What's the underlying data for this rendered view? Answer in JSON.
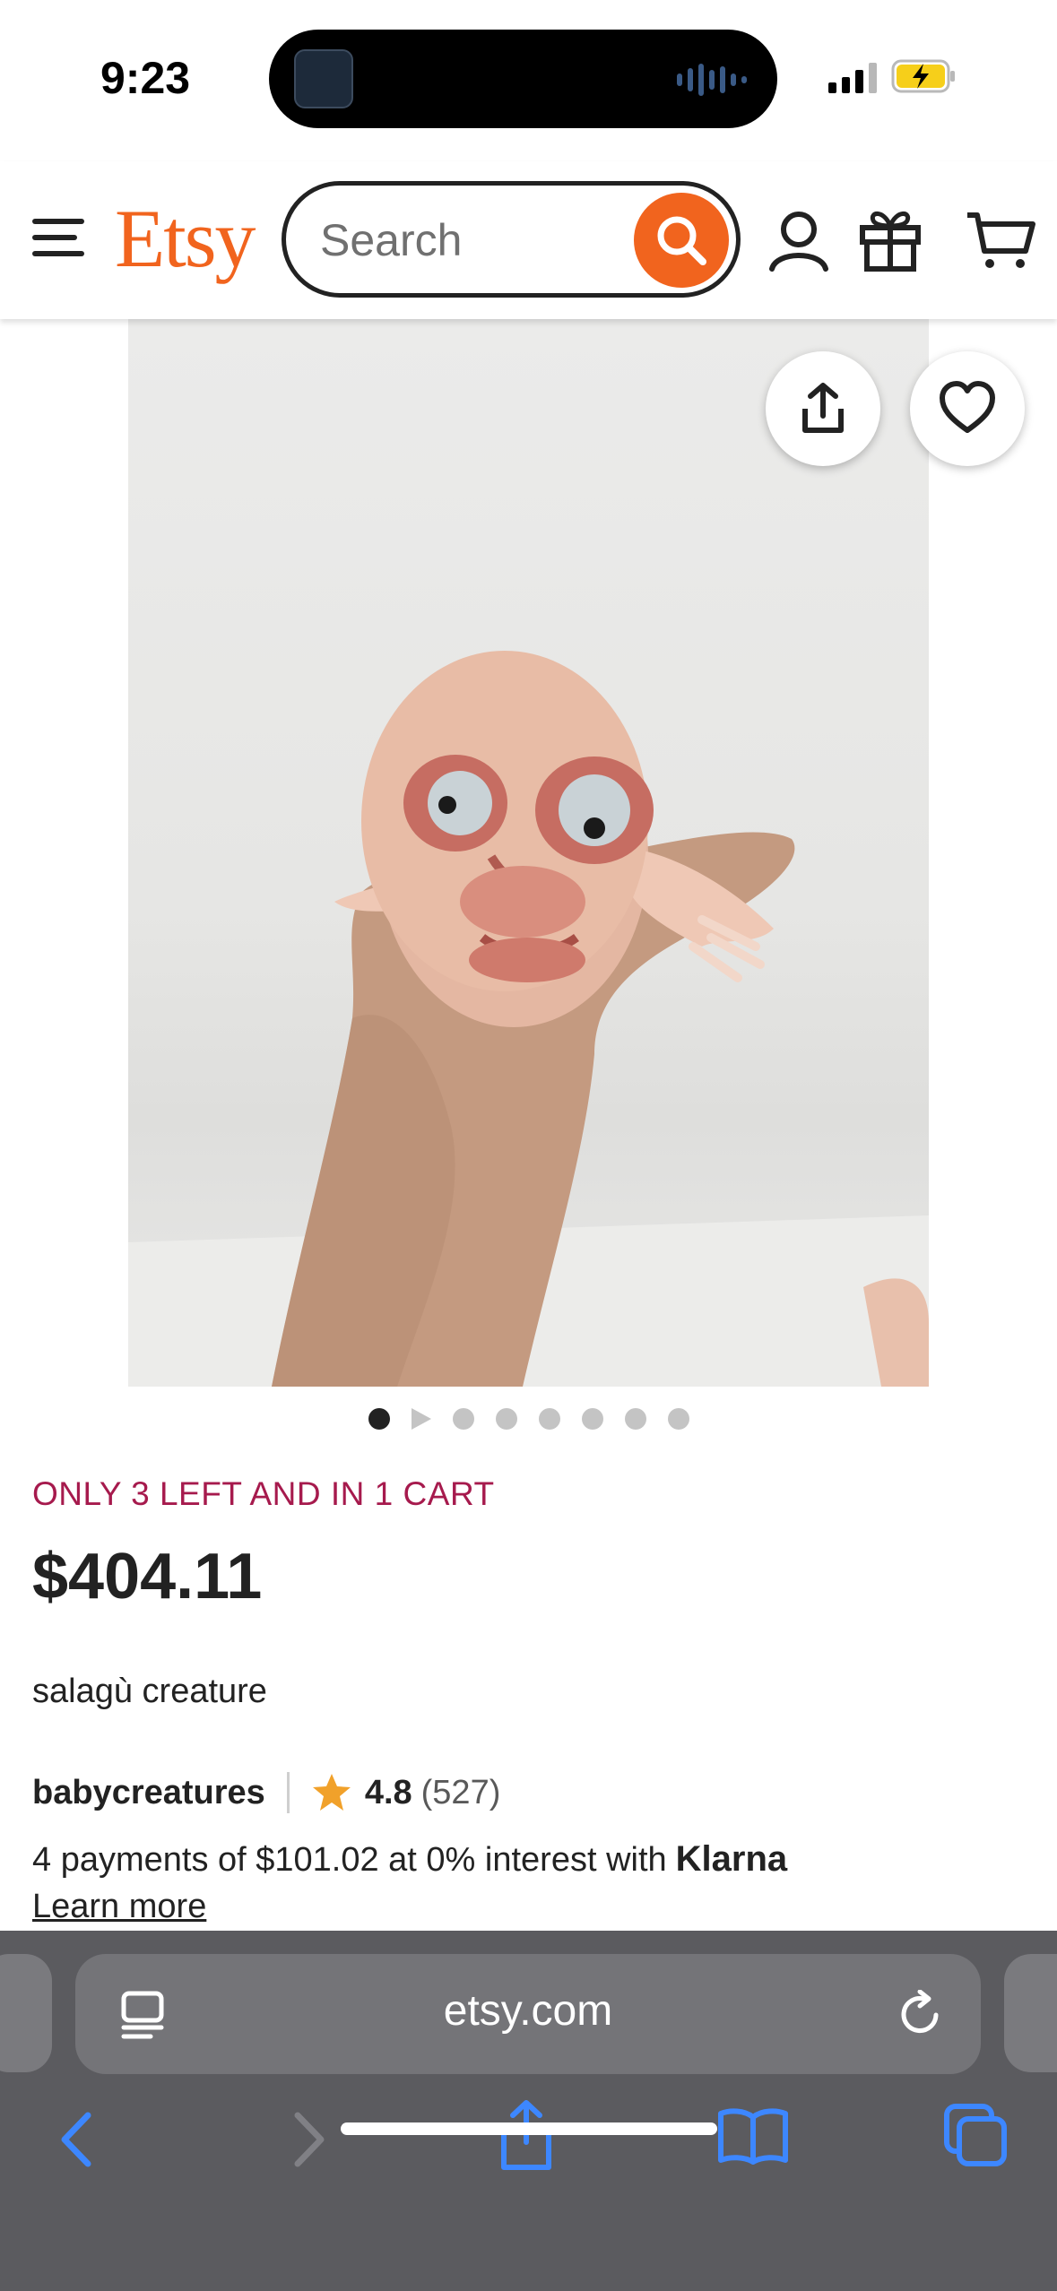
{
  "status_bar": {
    "time": "9:23"
  },
  "header": {
    "logo": "Etsy",
    "search_placeholder": "Search",
    "brand_color": "#f1641e",
    "icons": [
      "menu-icon",
      "search-icon",
      "account-icon",
      "gift-icon",
      "cart-icon"
    ]
  },
  "product": {
    "image_count": 8,
    "active_image_index": 0,
    "video_slide_index": 1,
    "stock_note": "ONLY 3 LEFT AND IN 1 CART",
    "price": "$404.11",
    "title": "salagù creature",
    "shop_name": "babycreatures",
    "rating": "4.8",
    "review_count": "(527)",
    "installments_text": "4 payments of $101.02 at 0% interest with",
    "installments_provider": "Klarna",
    "learn_more": "Learn more",
    "stock_note_color": "#a61a4d",
    "rating_star_color": "#f1a12a"
  },
  "browser": {
    "url": "etsy.com",
    "bar_color": "#5b5b5f",
    "accent_color": "#3d87ff",
    "toolbar_icons": [
      "back-icon",
      "forward-icon",
      "share-icon",
      "bookmarks-icon",
      "tabs-icon"
    ]
  }
}
